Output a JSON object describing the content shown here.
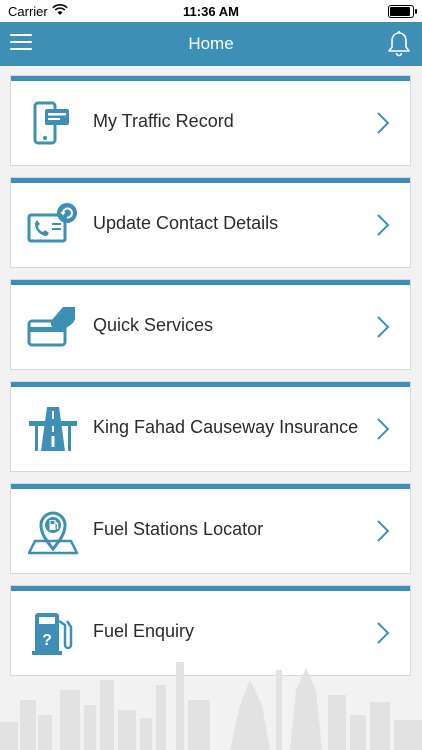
{
  "status": {
    "carrier": "Carrier",
    "time": "11:36 AM"
  },
  "header": {
    "title": "Home"
  },
  "items": [
    {
      "label": "My Traffic Record",
      "icon": "traffic-record-icon"
    },
    {
      "label": "Update Contact Details",
      "icon": "contact-card-icon"
    },
    {
      "label": "Quick Services",
      "icon": "card-hand-icon"
    },
    {
      "label": "King Fahad Causeway Insurance",
      "icon": "causeway-icon"
    },
    {
      "label": "Fuel Stations Locator",
      "icon": "map-pin-fuel-icon"
    },
    {
      "label": "Fuel Enquiry",
      "icon": "fuel-pump-icon"
    }
  ],
  "colors": {
    "accent": "#3d8fb6",
    "icon": "#3d8fb6",
    "background": "#f2f2f2"
  }
}
